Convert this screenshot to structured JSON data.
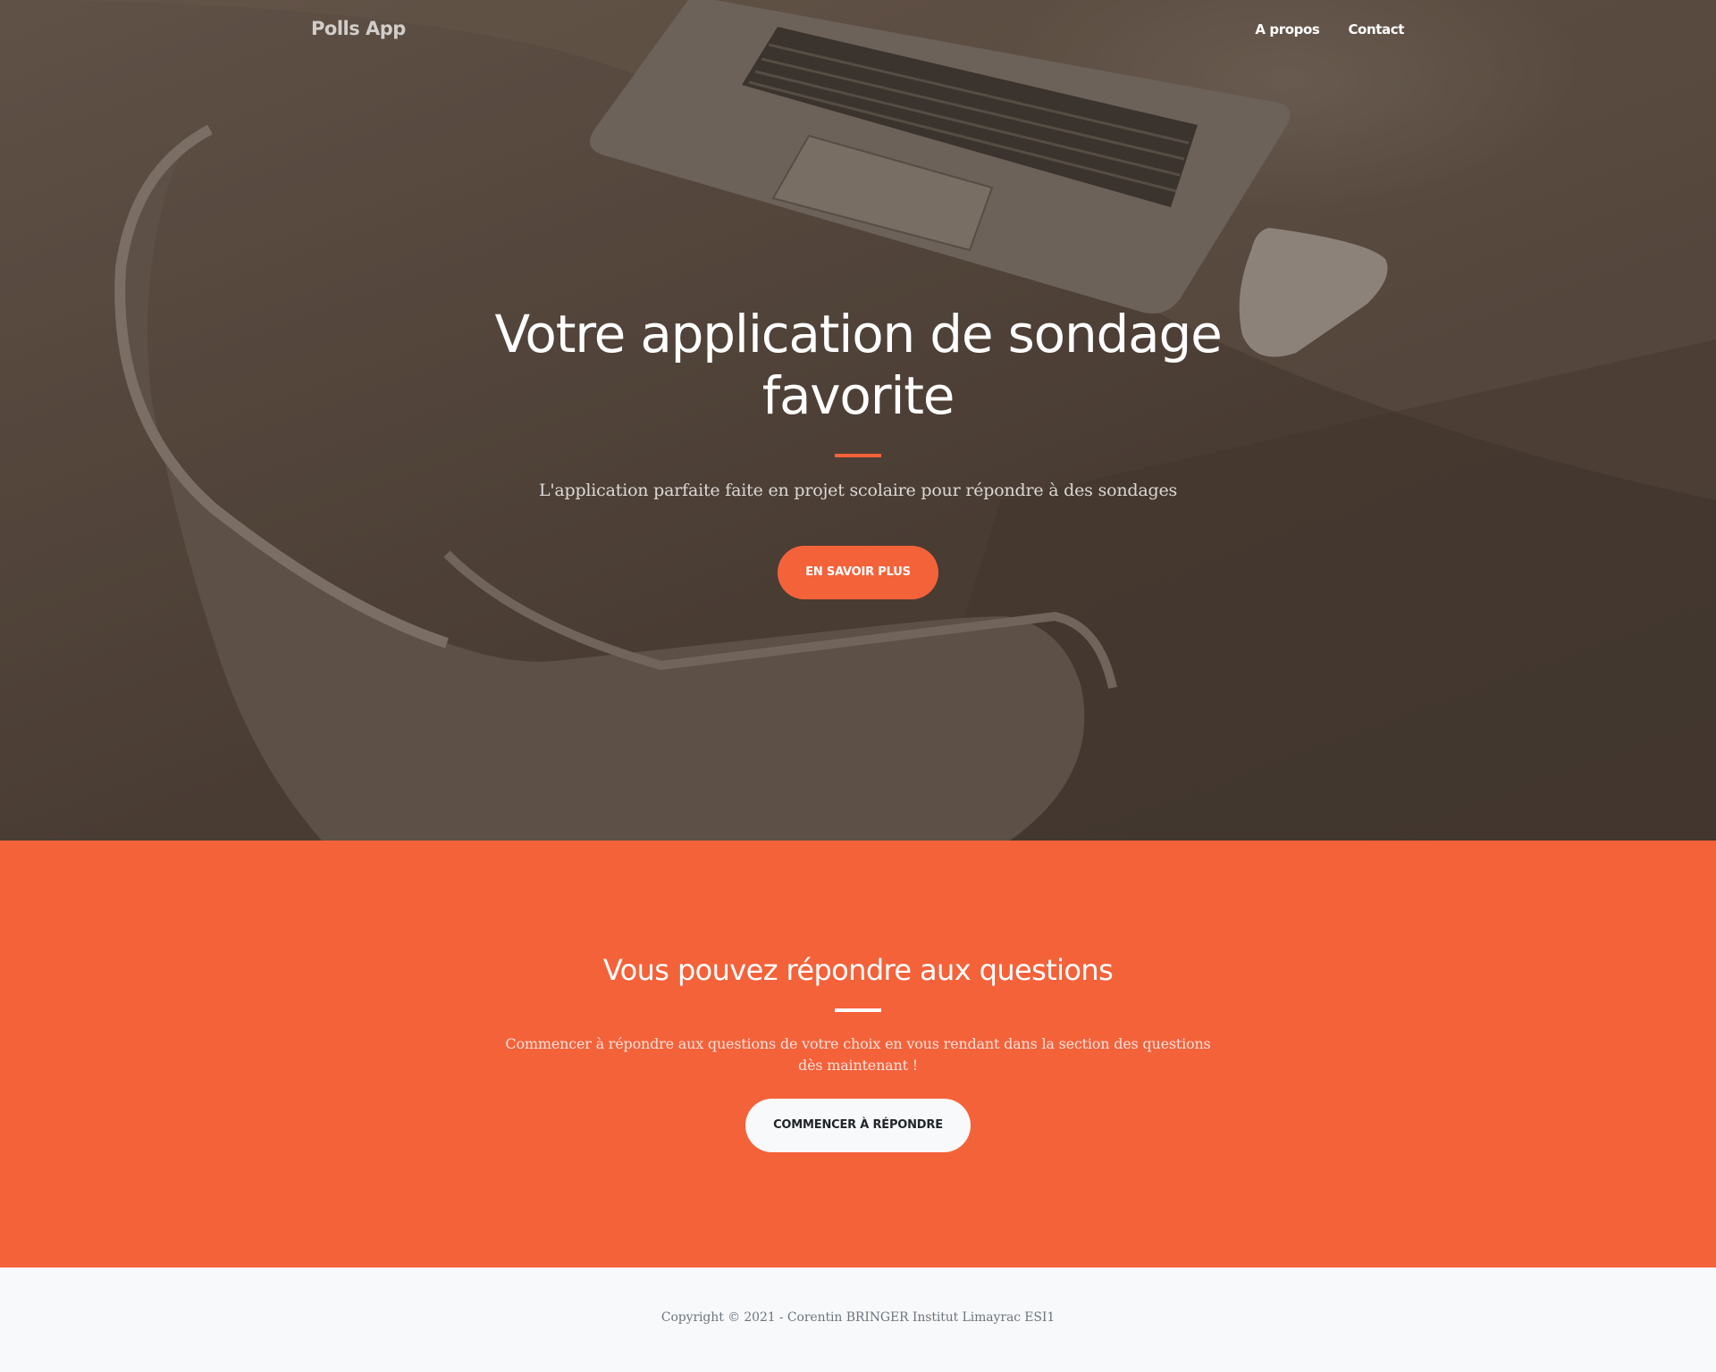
{
  "navbar": {
    "brand": "Polls App",
    "links": [
      "A propos",
      "Contact"
    ]
  },
  "hero": {
    "title_line1": "Votre application de sondage",
    "title_line2": "favorite",
    "subtitle": "L'application parfaite faite en projet scolaire pour répondre à des sondages",
    "button_label": "EN SAVOIR PLUS"
  },
  "answer_section": {
    "title": "Vous pouvez répondre aux questions",
    "text_line1": "Commencer à répondre aux questions de votre choix en vous rendant dans la section des questions",
    "text_line2": "dès maintenant !",
    "button_label": "COMMENCER À RÉPONDRE"
  },
  "footer": {
    "copyright": "Copyright © 2021 - Corentin BRINGER Institut Limayrac ESI1"
  },
  "colors": {
    "accent": "#f4623a",
    "light": "#f8f9fa",
    "muted_text": "#6c757d"
  }
}
